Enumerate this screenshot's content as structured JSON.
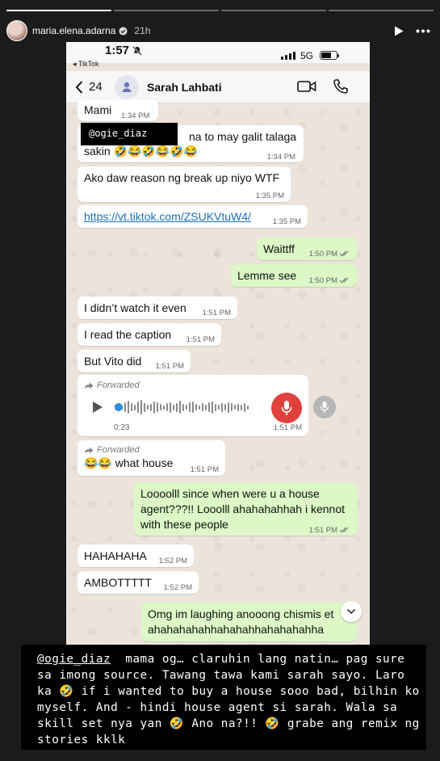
{
  "story": {
    "username": "maria.elena.adarna",
    "time_ago": "21h",
    "caption_mention": "@ogie_diaz",
    "caption_text": "  mama og… claruhin lang natin… pag sure sa imong source. Tawang tawa kami sarah sayo. Laro ka 🤣 if i wanted to buy a house sooo bad, bilhin ko myself. And - hindi house agent si sarah. Wala sa skill set nya yan 🤣 Ano na?!! 🤣 grabe ang remix ng stories kklk"
  },
  "status_bar": {
    "time": "1:57",
    "network": "5G",
    "back_app": "◂ TikTok"
  },
  "chat": {
    "back_count": "24",
    "contact_name": "Sarah Lahbati",
    "mention_overlay": "@ogie_diaz",
    "messages": [
      {
        "text": "Mami",
        "time": "1:34 PM"
      },
      {
        "text": "na to may galit talaga",
        "text2": "sakin 🤣😂🤣😂🤣😂",
        "time": "1:34 PM"
      },
      {
        "text": "Ako daw reason ng break up niyo WTF",
        "time": "1:35 PM"
      },
      {
        "text": "https://vt.tiktok.com/ZSUKVtuW4/",
        "time": "1:35 PM"
      },
      {
        "text": "Waittff",
        "time": "1:50 PM"
      },
      {
        "text": "Lemme see",
        "time": "1:50 PM"
      },
      {
        "text": "I didn’t watch it even",
        "time": "1:51 PM"
      },
      {
        "text": "I read the caption",
        "time": "1:51 PM"
      },
      {
        "text": "But Vito did",
        "time": "1:51 PM"
      },
      {
        "forwarded": "Forwarded",
        "duration": "0:23",
        "time": "1:51 PM"
      },
      {
        "forwarded": "Forwarded",
        "text": "😂😂 what house",
        "time": "1:51 PM"
      },
      {
        "text": "Loooolll since when were u a house",
        "text2": "agent???!! Looolll ahahahahhah i kennot",
        "text3": "with these people",
        "time": "1:51 PM"
      },
      {
        "text": "HAHAHAHA",
        "time": "1:52 PM"
      },
      {
        "text": "AMBOTTTTT",
        "time": "1:52 PM"
      },
      {
        "text": "Omg im laughing anooong chismis et",
        "text2": "ahahahahahhahahahhahahahahha"
      }
    ]
  }
}
